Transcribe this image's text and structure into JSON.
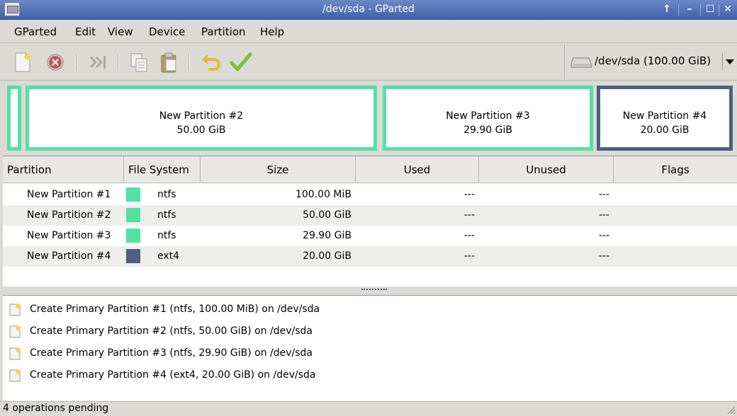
{
  "window": {
    "title": "/dev/sda - GParted"
  },
  "menu": {
    "items": [
      {
        "label": "GParted"
      },
      {
        "label": "Edit"
      },
      {
        "label": "View"
      },
      {
        "label": "Device"
      },
      {
        "label": "Partition"
      },
      {
        "label": "Help"
      }
    ]
  },
  "toolbar": {
    "device_label": "/dev/sda  (100.00 GiB)"
  },
  "partition_map": [
    {
      "name": "New Partition #2",
      "size": "50.00 GiB"
    },
    {
      "name": "New Partition #3",
      "size": "29.90 GiB"
    },
    {
      "name": "New Partition #4",
      "size": "20.00 GiB"
    }
  ],
  "table": {
    "headers": [
      "Partition",
      "File System",
      "Size",
      "Used",
      "Unused",
      "Flags"
    ],
    "rows": [
      {
        "partition": "New Partition #1",
        "fs": "ntfs",
        "size": "100.00 MiB",
        "used": "---",
        "unused": "---",
        "flags": "",
        "color": "#53e1a4"
      },
      {
        "partition": "New Partition #2",
        "fs": "ntfs",
        "size": "50.00 GiB",
        "used": "---",
        "unused": "---",
        "flags": "",
        "color": "#53e1a4"
      },
      {
        "partition": "New Partition #3",
        "fs": "ntfs",
        "size": "29.90 GiB",
        "used": "---",
        "unused": "---",
        "flags": "",
        "color": "#53e1a4"
      },
      {
        "partition": "New Partition #4",
        "fs": "ext4",
        "size": "20.00 GiB",
        "used": "---",
        "unused": "---",
        "flags": "",
        "color": "#4c6080"
      }
    ]
  },
  "operations": [
    {
      "label": "Create Primary Partition #1 (ntfs, 100.00 MiB) on /dev/sda"
    },
    {
      "label": "Create Primary Partition #2 (ntfs, 50.00 GiB) on /dev/sda"
    },
    {
      "label": "Create Primary Partition #3 (ntfs, 29.90 GiB) on /dev/sda"
    },
    {
      "label": "Create Primary Partition #4 (ext4, 20.00 GiB) on /dev/sda"
    }
  ],
  "status": {
    "text": "4 operations pending"
  },
  "colors": {
    "ntfs": "#53e1a4",
    "ext4": "#4c6080",
    "titlebar": "#3f62a8"
  },
  "icons": [
    "new-icon",
    "delete-icon",
    "resize-move-icon",
    "copy-icon",
    "paste-icon",
    "undo-icon",
    "apply-icon",
    "harddisk-icon"
  ]
}
